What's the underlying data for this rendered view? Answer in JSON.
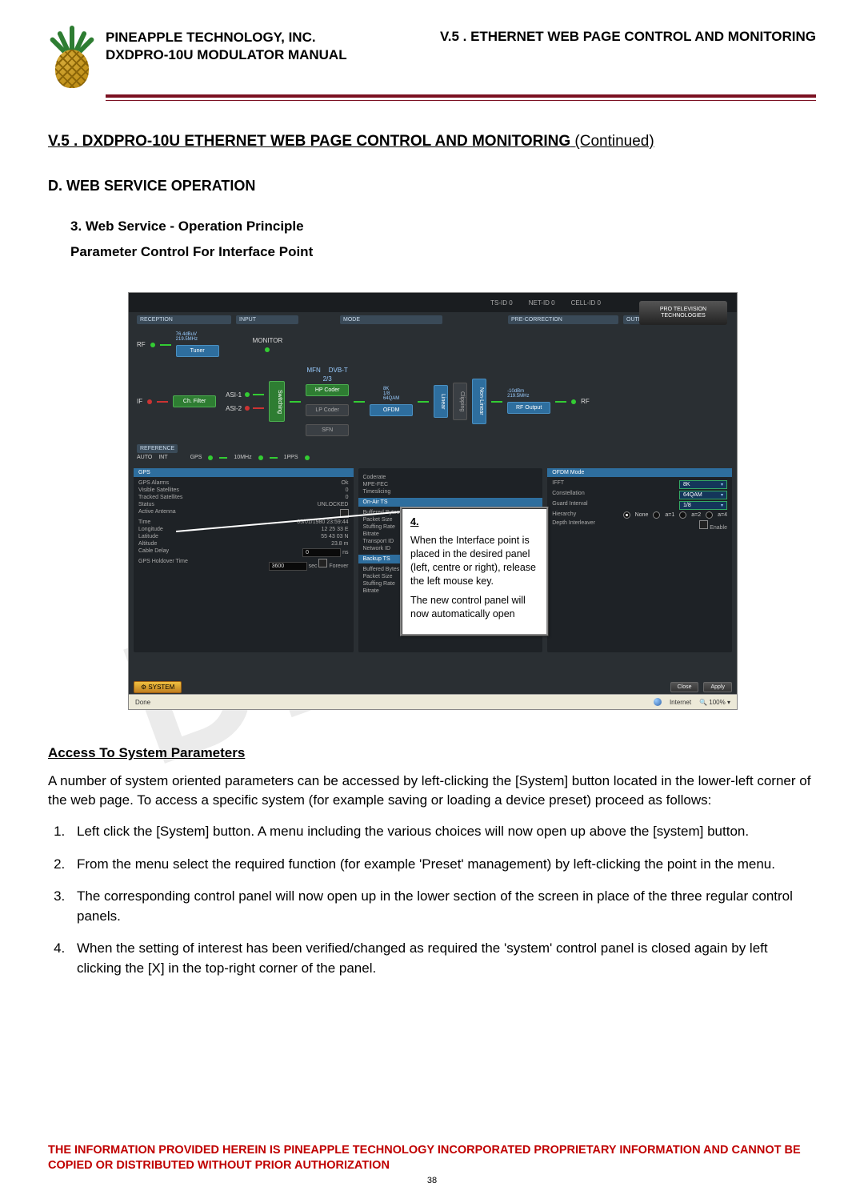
{
  "header": {
    "company": "PINEAPPLE TECHNOLOGY, INC.",
    "manual": "DXDPRO-10U MODULATOR MANUAL",
    "chapter": "V.5 . ETHERNET WEB PAGE CONTROL AND MONITORING"
  },
  "watermark": "DRAFT",
  "title_main": "V.5 . DXDPRO-10U ETHERNET WEB PAGE CONTROL AND MONITORING",
  "title_cont": "(Continued)",
  "heading_d": "D.  WEB SERVICE OPERATION",
  "heading_3": "3.    Web Service - Operation Principle",
  "heading_param": "Parameter Control For Interface Point",
  "screenshot": {
    "topbar": {
      "ts": "TS-ID 0",
      "net": "NET-ID 0",
      "cell": "CELL-ID 0"
    },
    "brand": "PRO TELEVISION TECHNOLOGIES",
    "sections": {
      "reception": "RECEPTION",
      "input": "INPUT",
      "mode": "MODE",
      "precorr": "PRE-CORRECTION",
      "output": "OUTPUT",
      "reference": "REFERENCE"
    },
    "rf_label": "RF",
    "if_label": "IF",
    "tuner": "Tuner",
    "tuner_info1": "76.4dBuV",
    "tuner_info2": "219.5MHz",
    "chfilter": "Ch. Filter",
    "asi1": "ASI-1",
    "asi2": "ASI-2",
    "monitor": "MONITOR",
    "switching": "Switching",
    "mode1": "MFN",
    "mode2": "DVB-T",
    "hpcoder": "HP Coder",
    "lpcoder": "LP Coder",
    "hp_rate": "2/3",
    "ofdm": "OFDM",
    "ofdm_sub1": "8K",
    "ofdm_sub2": "1/8",
    "ofdm_sub3": "64QAM",
    "sfn": "SFN",
    "linear": "Linear",
    "clipping": "Clipping",
    "nonlinear": "Non-Linear",
    "rfoutput": "RF Output",
    "rfout_sub1": "-10dBm",
    "rfout_sub2": "219.5MHz",
    "ref": {
      "auto": "AUTO",
      "int": "INT",
      "gps": "GPS",
      "tenmhz": "10MHz",
      "onepps": "1PPS"
    },
    "gps": {
      "title": "GPS",
      "alarms_l": "GPS Alarms",
      "alarms_v": "Ok",
      "vis_l": "Visible Satellites",
      "vis_v": "0",
      "trk_l": "Tracked Satellites",
      "trk_v": "0",
      "status_l": "Status",
      "status_v": "UNLOCKED",
      "ant_l": "Active Antenna",
      "time_l": "Time",
      "time_v": "05/01/1980 23:59:44",
      "lon_l": "Longitude",
      "lon_v": "12 25 33 E",
      "lat_l": "Latitude",
      "lat_v": "55 43 03 N",
      "alt_l": "Altitude",
      "alt_v": "23.8",
      "alt_u": "m",
      "cdly_l": "Cable Delay",
      "cdly_v": "0",
      "cdly_u": "ns",
      "hold_l": "GPS Holdover Time",
      "hold_v": "3600",
      "hold_u": "sec",
      "forever": "Forever"
    },
    "mid": {
      "coderate_l": "Coderate",
      "mpefec_l": "MPE-FEC",
      "timeslice_l": "Timeslicing",
      "onair": "On-Air TS",
      "buf_l": "Buffered Bytes",
      "pkt_l": "Packet Size",
      "stuf_l": "Stuffing Rate",
      "bitr_l": "Bitrate",
      "tid_l": "Transport ID",
      "netid_l": "Network ID",
      "backup": "Backup TS",
      "buf2_l": "Buffered Bytes",
      "pkt2_l": "Packet Size",
      "stuf2_l": "Stuffing Rate",
      "bitr2_l": "Bitrate"
    },
    "ofdm_panel": {
      "title": "OFDM Mode",
      "ifft_l": "IFFT",
      "ifft_v": "8K",
      "const_l": "Constellation",
      "const_v": "64QAM",
      "guard_l": "Guard Interval",
      "guard_v": "1/8",
      "hier_l": "Hierarchy",
      "hier_opts": [
        "None",
        "a=1",
        "a=2",
        "a=4"
      ],
      "deep_l": "Depth Interleaver",
      "deep_v": "Enable"
    },
    "system_btn": "SYSTEM",
    "close_btn": "Close",
    "apply_btn": "Apply",
    "status_done": "Done",
    "status_internet": "Internet",
    "status_zoom": "100%"
  },
  "callout": {
    "num": "4.",
    "p1": "When the Interface point is placed in the desired panel (left, centre or right), release the left mouse key.",
    "p2": "The new control panel will now automatically open"
  },
  "access": {
    "heading": "Access To System Parameters",
    "intro": "A number of system oriented parameters can be accessed by left-clicking the [System] button located in the lower-left corner of the web page. To access a specific system (for example saving or loading a device preset) proceed as follows:",
    "steps": [
      "Left click the [System] button. A menu including the various choices will now open up above the [system] button.",
      "From the menu select the required function (for example 'Preset' management) by left-clicking the point in the menu.",
      "The corresponding control panel will now open up in the lower section of the screen in place of the three regular control panels.",
      "When the setting of interest has been verified/changed as required the 'system' control panel is closed again by left clicking the [X] in the top-right corner of the panel."
    ]
  },
  "footer": {
    "proprietary": "THE INFORMATION PROVIDED HEREIN IS PINEAPPLE TECHNOLOGY INCORPORATED PROPRIETARY INFORMATION AND CANNOT BE COPIED OR DISTRIBUTED WITHOUT PRIOR AUTHORIZATION",
    "page": "38"
  }
}
